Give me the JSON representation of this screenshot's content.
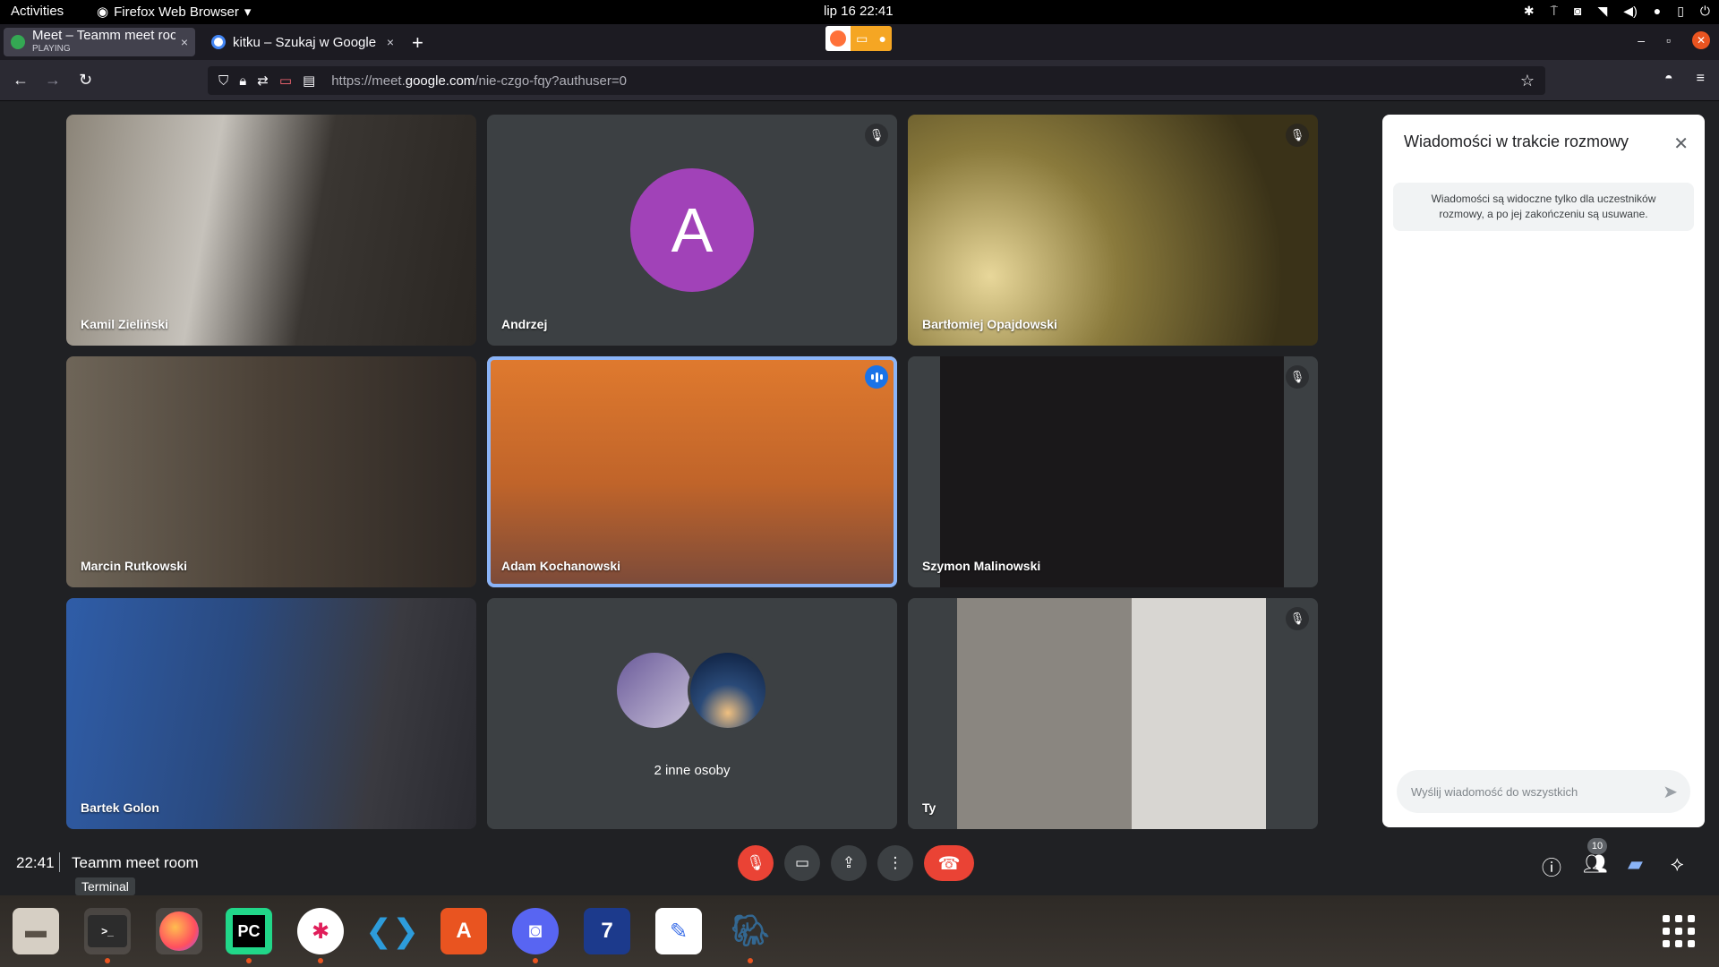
{
  "topbar": {
    "activities": "Activities",
    "app_name": "Firefox Web Browser",
    "clock": "lip 16  22:41"
  },
  "tabs": [
    {
      "title": "Meet – Teamm meet roo",
      "subtitle": "PLAYING",
      "close": "×"
    },
    {
      "title": "kitku – Szukaj w Google",
      "close": "×"
    }
  ],
  "newtab": "+",
  "url": {
    "prefix": "https://meet.",
    "domain": "google.com",
    "path": "/nie-czgo-fqy?authuser=0"
  },
  "tiles": [
    {
      "name": "Kamil Zieliński",
      "muted": false,
      "bg": "#5a5246"
    },
    {
      "name": "Andrzej",
      "muted": true,
      "avatar_letter": "A",
      "avatar_color": "#a142b8"
    },
    {
      "name": "Bartłomiej Opajdowski",
      "muted": true,
      "bg": "#6b5a2e"
    },
    {
      "name": "Marcin Rutkowski",
      "muted": false,
      "bg": "#4a4038"
    },
    {
      "name": "Adam Kochanowski",
      "muted": false,
      "speaking": true,
      "bg": "#c86a2a"
    },
    {
      "name": "Szymon Malinowski",
      "muted": true,
      "bg": "#1c1a1c"
    },
    {
      "name": "Bartek Golon",
      "muted": false,
      "bg": "#2e4a78"
    },
    {
      "name": "",
      "others_label": "2 inne osoby"
    },
    {
      "name": "Ty",
      "muted": true,
      "bg": "#6a6660"
    }
  ],
  "chat": {
    "title": "Wiadomości w trakcie rozmowy",
    "notice": "Wiadomości są widoczne tylko dla uczestników rozmowy, a po jej zakończeniu są usuwane.",
    "input_placeholder": "Wyślij wiadomość do wszystkich"
  },
  "meetbar": {
    "time": "22:41",
    "room": "Teamm meet room",
    "tooltip": "Terminal",
    "participants_count": "10"
  },
  "dock": [
    "Files",
    "Terminal",
    "Firefox",
    "PyCharm",
    "Slack",
    "VS Code",
    "Ubuntu Software",
    "Discord",
    "Notes",
    "Text Editor",
    "pgAdmin"
  ]
}
